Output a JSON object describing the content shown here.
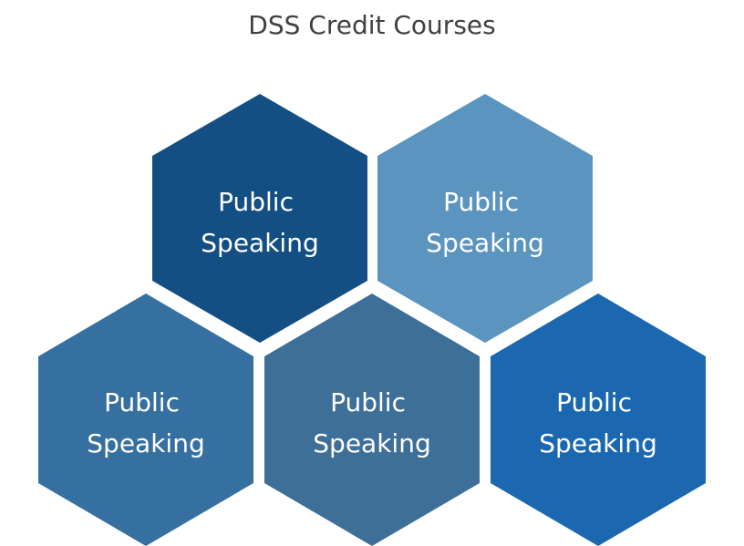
{
  "title": "DSS Credit Courses",
  "hexagons": [
    {
      "line1": "Public",
      "line2": "Speaking",
      "color": "#144F84"
    },
    {
      "line1": "Public",
      "line2": "Speaking",
      "color": "#5B95BF"
    },
    {
      "line1": "Public",
      "line2": "Speaking",
      "color": "#3570A0"
    },
    {
      "line1": "Public",
      "line2": "Speaking",
      "color": "#3E6F99"
    },
    {
      "line1": "Public",
      "line2": "Speaking",
      "color": "#1B68B1"
    }
  ]
}
